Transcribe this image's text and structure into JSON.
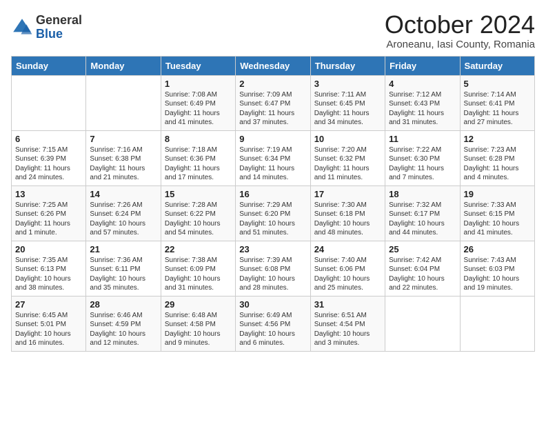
{
  "logo": {
    "general": "General",
    "blue": "Blue"
  },
  "title": "October 2024",
  "subtitle": "Aroneanu, Iasi County, Romania",
  "headers": [
    "Sunday",
    "Monday",
    "Tuesday",
    "Wednesday",
    "Thursday",
    "Friday",
    "Saturday"
  ],
  "weeks": [
    [
      {
        "day": "",
        "info": ""
      },
      {
        "day": "",
        "info": ""
      },
      {
        "day": "1",
        "info": "Sunrise: 7:08 AM\nSunset: 6:49 PM\nDaylight: 11 hours and 41 minutes."
      },
      {
        "day": "2",
        "info": "Sunrise: 7:09 AM\nSunset: 6:47 PM\nDaylight: 11 hours and 37 minutes."
      },
      {
        "day": "3",
        "info": "Sunrise: 7:11 AM\nSunset: 6:45 PM\nDaylight: 11 hours and 34 minutes."
      },
      {
        "day": "4",
        "info": "Sunrise: 7:12 AM\nSunset: 6:43 PM\nDaylight: 11 hours and 31 minutes."
      },
      {
        "day": "5",
        "info": "Sunrise: 7:14 AM\nSunset: 6:41 PM\nDaylight: 11 hours and 27 minutes."
      }
    ],
    [
      {
        "day": "6",
        "info": "Sunrise: 7:15 AM\nSunset: 6:39 PM\nDaylight: 11 hours and 24 minutes."
      },
      {
        "day": "7",
        "info": "Sunrise: 7:16 AM\nSunset: 6:38 PM\nDaylight: 11 hours and 21 minutes."
      },
      {
        "day": "8",
        "info": "Sunrise: 7:18 AM\nSunset: 6:36 PM\nDaylight: 11 hours and 17 minutes."
      },
      {
        "day": "9",
        "info": "Sunrise: 7:19 AM\nSunset: 6:34 PM\nDaylight: 11 hours and 14 minutes."
      },
      {
        "day": "10",
        "info": "Sunrise: 7:20 AM\nSunset: 6:32 PM\nDaylight: 11 hours and 11 minutes."
      },
      {
        "day": "11",
        "info": "Sunrise: 7:22 AM\nSunset: 6:30 PM\nDaylight: 11 hours and 7 minutes."
      },
      {
        "day": "12",
        "info": "Sunrise: 7:23 AM\nSunset: 6:28 PM\nDaylight: 11 hours and 4 minutes."
      }
    ],
    [
      {
        "day": "13",
        "info": "Sunrise: 7:25 AM\nSunset: 6:26 PM\nDaylight: 11 hours and 1 minute."
      },
      {
        "day": "14",
        "info": "Sunrise: 7:26 AM\nSunset: 6:24 PM\nDaylight: 10 hours and 57 minutes."
      },
      {
        "day": "15",
        "info": "Sunrise: 7:28 AM\nSunset: 6:22 PM\nDaylight: 10 hours and 54 minutes."
      },
      {
        "day": "16",
        "info": "Sunrise: 7:29 AM\nSunset: 6:20 PM\nDaylight: 10 hours and 51 minutes."
      },
      {
        "day": "17",
        "info": "Sunrise: 7:30 AM\nSunset: 6:18 PM\nDaylight: 10 hours and 48 minutes."
      },
      {
        "day": "18",
        "info": "Sunrise: 7:32 AM\nSunset: 6:17 PM\nDaylight: 10 hours and 44 minutes."
      },
      {
        "day": "19",
        "info": "Sunrise: 7:33 AM\nSunset: 6:15 PM\nDaylight: 10 hours and 41 minutes."
      }
    ],
    [
      {
        "day": "20",
        "info": "Sunrise: 7:35 AM\nSunset: 6:13 PM\nDaylight: 10 hours and 38 minutes."
      },
      {
        "day": "21",
        "info": "Sunrise: 7:36 AM\nSunset: 6:11 PM\nDaylight: 10 hours and 35 minutes."
      },
      {
        "day": "22",
        "info": "Sunrise: 7:38 AM\nSunset: 6:09 PM\nDaylight: 10 hours and 31 minutes."
      },
      {
        "day": "23",
        "info": "Sunrise: 7:39 AM\nSunset: 6:08 PM\nDaylight: 10 hours and 28 minutes."
      },
      {
        "day": "24",
        "info": "Sunrise: 7:40 AM\nSunset: 6:06 PM\nDaylight: 10 hours and 25 minutes."
      },
      {
        "day": "25",
        "info": "Sunrise: 7:42 AM\nSunset: 6:04 PM\nDaylight: 10 hours and 22 minutes."
      },
      {
        "day": "26",
        "info": "Sunrise: 7:43 AM\nSunset: 6:03 PM\nDaylight: 10 hours and 19 minutes."
      }
    ],
    [
      {
        "day": "27",
        "info": "Sunrise: 6:45 AM\nSunset: 5:01 PM\nDaylight: 10 hours and 16 minutes."
      },
      {
        "day": "28",
        "info": "Sunrise: 6:46 AM\nSunset: 4:59 PM\nDaylight: 10 hours and 12 minutes."
      },
      {
        "day": "29",
        "info": "Sunrise: 6:48 AM\nSunset: 4:58 PM\nDaylight: 10 hours and 9 minutes."
      },
      {
        "day": "30",
        "info": "Sunrise: 6:49 AM\nSunset: 4:56 PM\nDaylight: 10 hours and 6 minutes."
      },
      {
        "day": "31",
        "info": "Sunrise: 6:51 AM\nSunset: 4:54 PM\nDaylight: 10 hours and 3 minutes."
      },
      {
        "day": "",
        "info": ""
      },
      {
        "day": "",
        "info": ""
      }
    ]
  ]
}
